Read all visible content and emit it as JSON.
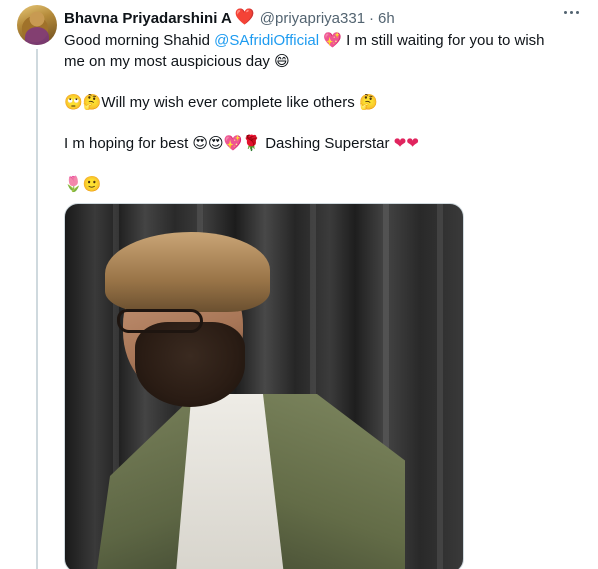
{
  "tweet": {
    "author": {
      "display_name": "Bhavna Priyadarshini A",
      "name_badge": "❤️",
      "handle": "@priyapriya331",
      "separator": "·",
      "time": "6h"
    },
    "more_icon": "more-horizontal-icon",
    "text": {
      "line1_prefix": "Good morning Shahid ",
      "mention": "@SAfridiOfficial",
      "line1_emoji": "💖",
      "line1_suffix": " I m still waiting for you to wish me on my most auspicious day ",
      "line1_end_emoji": "😄",
      "para2_emoji": "🙄🤔",
      "para2_text": "Will my wish ever  complete  like others ",
      "para2_end_emoji": "🤔",
      "para3_text": "I m hoping for best ",
      "para3_emojis": "😍😍💖🌹",
      "para3_label": "Dashing Superstar ",
      "para3_hearts": "❤❤",
      "para4_emojis": "🌷🙂"
    },
    "photo": {
      "alt": "Photo of a man with glasses and beard in an olive jacket"
    }
  },
  "colors": {
    "text": "#0f1419",
    "secondary": "#536471",
    "link": "#1d9bf0",
    "heart": "#e0245e",
    "thread_line": "#cfd9de"
  }
}
